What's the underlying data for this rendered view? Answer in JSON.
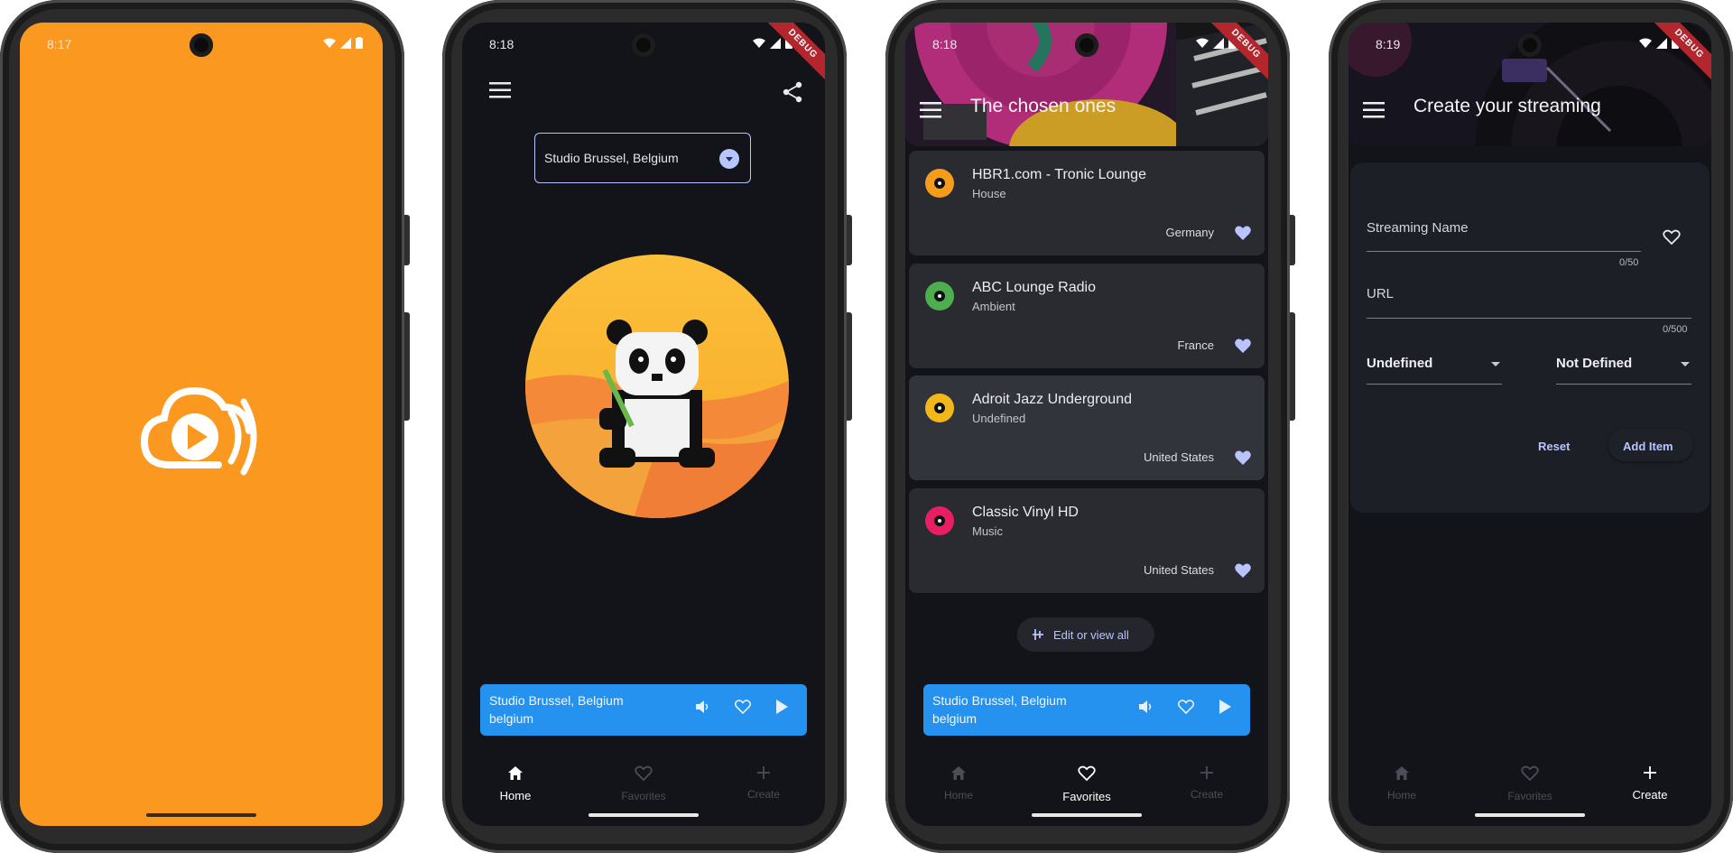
{
  "splash": {
    "time": "8:17"
  },
  "home": {
    "time": "8:18",
    "debug": "DEBUG",
    "station_dropdown": "Studio Brussel, Belgium"
  },
  "favorites": {
    "time": "8:18",
    "debug": "DEBUG",
    "title": "The chosen ones",
    "stations": [
      {
        "name": "HBR1.com - Tronic Lounge",
        "genre": "House",
        "country": "Germany",
        "color": "#f49c1c"
      },
      {
        "name": "ABC Lounge Radio",
        "genre": "Ambient",
        "country": "France",
        "color": "#4cae4f"
      },
      {
        "name": "Adroit Jazz Underground",
        "genre": "Undefined",
        "country": "United States",
        "color": "#f2b81a"
      },
      {
        "name": "Classic Vinyl HD",
        "genre": "Music",
        "country": "United States",
        "color": "#e81e63"
      }
    ],
    "edit_button": "Edit or view all"
  },
  "create": {
    "time": "8:19",
    "debug": "DEBUG",
    "title": "Create your streaming",
    "streaming_name_label": "Streaming Name",
    "streaming_name_counter": "0/50",
    "url_label": "URL",
    "url_counter": "0/500",
    "genre_select": "Undefined",
    "country_select": "Not Defined",
    "reset_button": "Reset",
    "add_button": "Add Item"
  },
  "player": {
    "title": "Studio Brussel, Belgium",
    "subtitle": "belgium"
  },
  "nav": {
    "home": "Home",
    "favorites": "Favorites",
    "create": "Create"
  },
  "colors": {
    "accent": "#b9c4ff",
    "player": "#2492ee",
    "splash": "#fb981f"
  }
}
